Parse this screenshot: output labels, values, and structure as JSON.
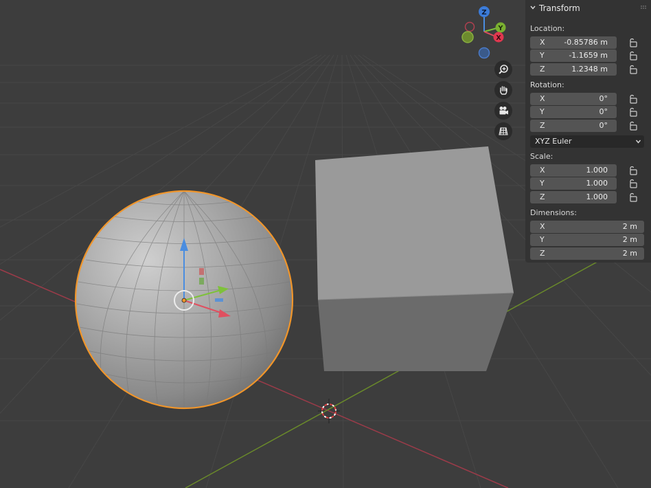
{
  "panel": {
    "title": "Transform",
    "location": {
      "label": "Location:",
      "fields": [
        {
          "axis": "X",
          "value": "-0.85786 m"
        },
        {
          "axis": "Y",
          "value": "-1.1659 m"
        },
        {
          "axis": "Z",
          "value": "1.2348 m"
        }
      ]
    },
    "rotation": {
      "label": "Rotation:",
      "fields": [
        {
          "axis": "X",
          "value": "0°"
        },
        {
          "axis": "Y",
          "value": "0°"
        },
        {
          "axis": "Z",
          "value": "0°"
        }
      ],
      "mode": "XYZ Euler"
    },
    "scale": {
      "label": "Scale:",
      "fields": [
        {
          "axis": "X",
          "value": "1.000"
        },
        {
          "axis": "Y",
          "value": "1.000"
        },
        {
          "axis": "Z",
          "value": "1.000"
        }
      ]
    },
    "dimensions": {
      "label": "Dimensions:",
      "fields": [
        {
          "axis": "X",
          "value": "2 m"
        },
        {
          "axis": "Y",
          "value": "2 m"
        },
        {
          "axis": "Z",
          "value": "2 m"
        }
      ]
    }
  },
  "gizmo": {
    "x": "X",
    "y": "Y",
    "z": "Z"
  },
  "colors": {
    "background": "#3d3d3d",
    "grid": "#474747",
    "x_axis": "#9b3b49",
    "y_axis": "#6a8a2a",
    "selection": "#f0952a",
    "panel": "#333333",
    "field": "#545454"
  }
}
